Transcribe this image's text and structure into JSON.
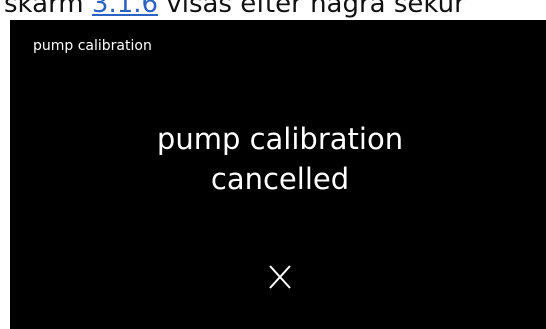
{
  "doc_caption": {
    "prefix": "skärm ",
    "link": "3.1.6",
    "suffix": " visas efter några sekur"
  },
  "screen": {
    "title": "pump calibration",
    "message_line1": "pump calibration",
    "message_line2": "cancelled"
  },
  "icons": {
    "close": "close-icon"
  },
  "colors": {
    "screen_bg": "#000000",
    "screen_text": "#ffffff",
    "link": "#2b63c4"
  }
}
